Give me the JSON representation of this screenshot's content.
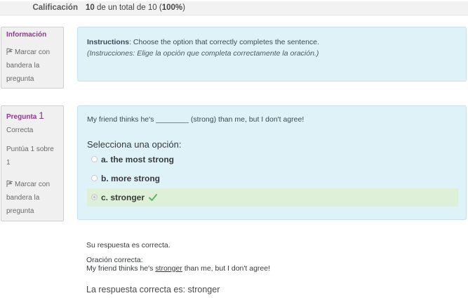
{
  "grade": {
    "label": "Calificación",
    "score": "10",
    "text_mid": " de un total de 10 (",
    "percent": "100%",
    "text_end": ")"
  },
  "info_side": {
    "title": "Información",
    "flag_label": "Marcar con bandera la pregunta"
  },
  "instructions": {
    "bold": "Instructions",
    "text": ": Choose the option that correctly completes the sentence.",
    "translation": "(Instrucciones: Elige la opción que completa correctamente la oración.)"
  },
  "question_side": {
    "title": "Pregunta",
    "number": "1",
    "state": "Correcta",
    "score": "Puntúa 1 sobre 1",
    "flag_label": "Marcar con bandera la pregunta"
  },
  "question": {
    "text": "My friend thinks he's ________ (strong) than me, but I don't agree!",
    "prompt": "Selecciona una opción:",
    "options": [
      {
        "label": "a. the most strong",
        "selected": false
      },
      {
        "label": "b. more strong",
        "selected": false
      },
      {
        "label": "c. stronger",
        "selected": true
      }
    ]
  },
  "feedback": {
    "result": "Su respuesta es correcta.",
    "correct_heading": "Oración correcta:",
    "sentence_before": "My friend thinks he's ",
    "sentence_answer": "stronger",
    "sentence_after": " than me, but I don't agree!",
    "right_answer": "La respuesta correcta es: stronger"
  },
  "colors": {
    "accent": "#8b3b8b",
    "info_box": "#def2f8",
    "correct_bg": "#dff0d8",
    "check": "#5cb85c"
  }
}
